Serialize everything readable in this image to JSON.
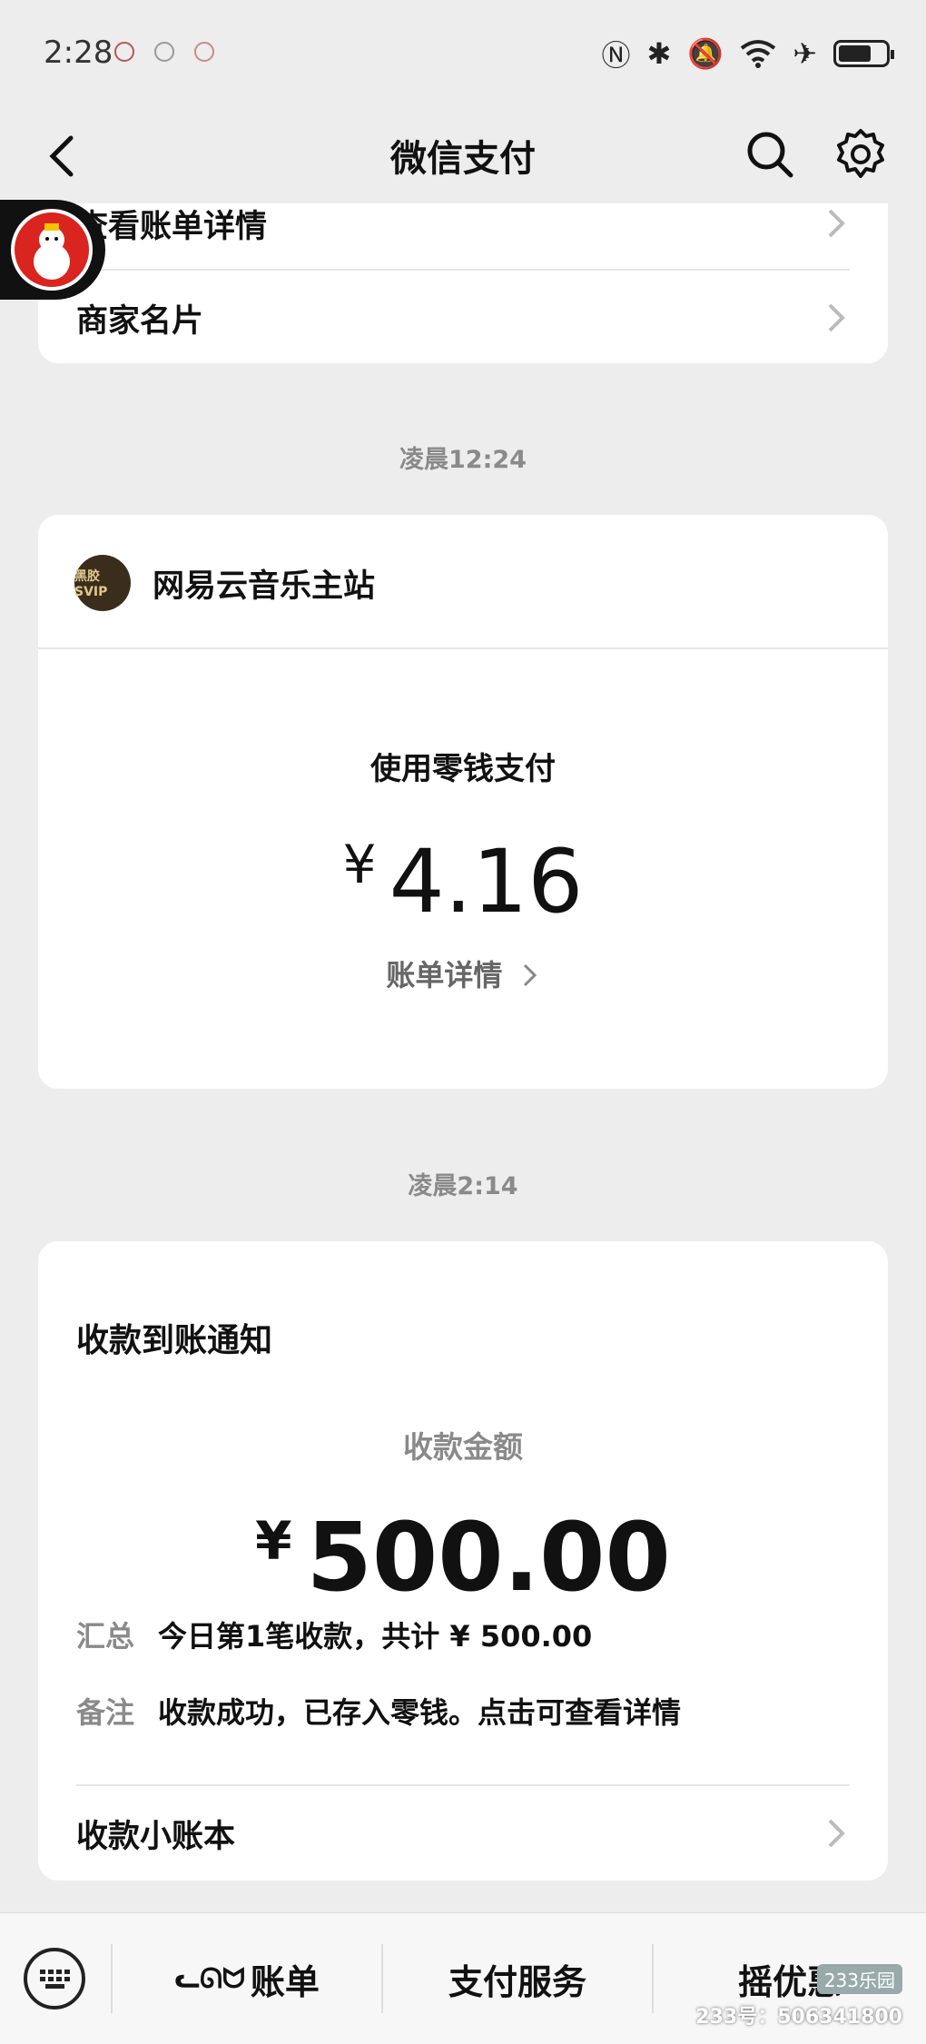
{
  "status": {
    "time": "2:28"
  },
  "header": {
    "title": "微信支付"
  },
  "card1": {
    "row1_label": "查看账单详情",
    "row2_label": "商家名片"
  },
  "timestamp1": "凌晨12:24",
  "merchant_card": {
    "logo_text": "黑胶SVIP",
    "merchant_name": "网易云音乐主站",
    "pay_method": "使用零钱支付",
    "currency": "¥",
    "amount": "4.16",
    "detail_link": "账单详情"
  },
  "timestamp2": "凌晨2:14",
  "receipt_card": {
    "title": "收款到账通知",
    "amount_label": "收款金额",
    "currency": "¥",
    "amount": "500.00",
    "summary_label": "汇总",
    "summary_value": "今日第1笔收款，共计 ¥ 500.00",
    "note_label": "备注",
    "note_value": "收款成功，已存入零钱。点击可查看详情",
    "ledger_label": "收款小账本"
  },
  "bottom_bar": {
    "tab1": "账单",
    "tab2": "支付服务",
    "tab3": "摇优惠"
  },
  "watermark": {
    "logo": "233乐园",
    "text": "233号：506341800"
  }
}
